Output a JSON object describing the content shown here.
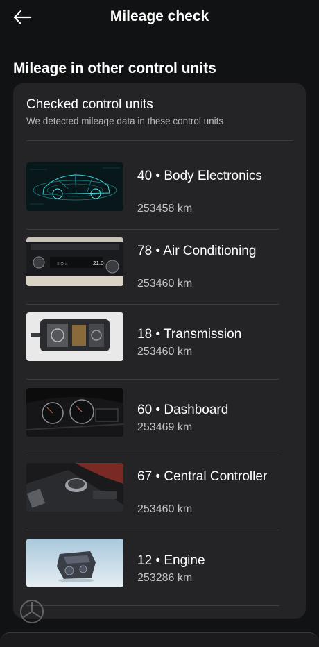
{
  "header": {
    "title": "Mileage check",
    "back_icon": "arrow-left-icon"
  },
  "section": {
    "title": "Mileage in other control units"
  },
  "card": {
    "title": "Checked control units",
    "subtitle": "We detected mileage data in these control units"
  },
  "units": [
    {
      "name": "40 • Body Electronics",
      "mileage": "253458 km",
      "image": "car-wireframe-image"
    },
    {
      "name": "78 • Air Conditioning",
      "mileage": "253460 km",
      "image": "climate-panel-image"
    },
    {
      "name": "18 • Transmission",
      "mileage": "253460 km",
      "image": "gearbox-image"
    },
    {
      "name": "60 • Dashboard",
      "mileage": "253469 km",
      "image": "instrument-cluster-image"
    },
    {
      "name": "67 • Central Controller",
      "mileage": "253460 km",
      "image": "idrive-knob-image"
    },
    {
      "name": "12 • Engine",
      "mileage": "253286 km",
      "image": "engine-image"
    }
  ]
}
